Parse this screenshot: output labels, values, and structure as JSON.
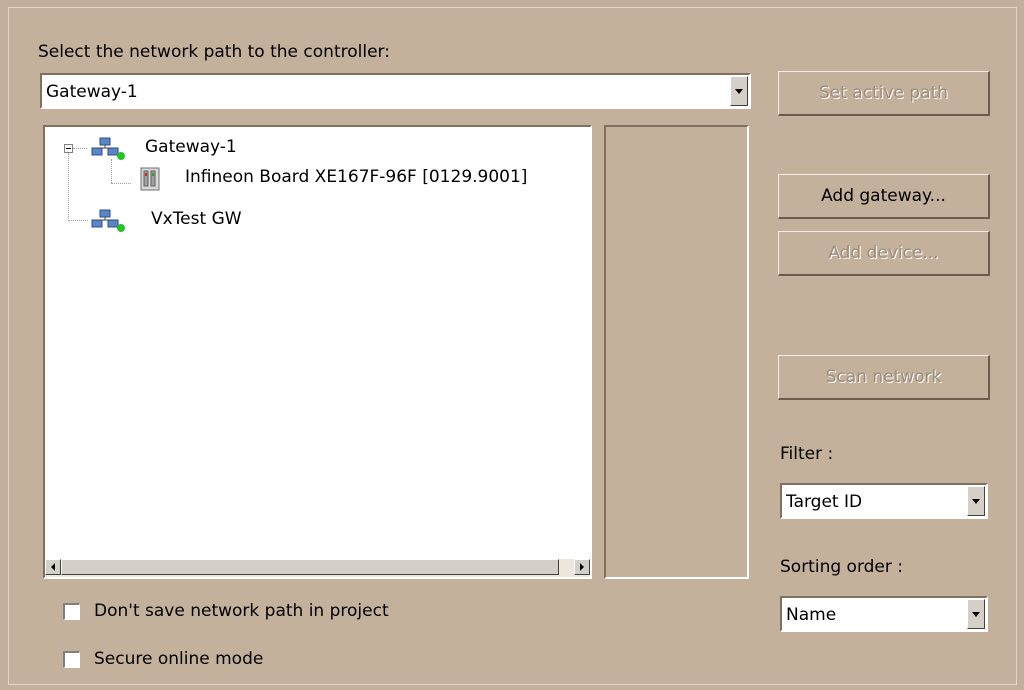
{
  "header_label": "Select the network path to the controller:",
  "path_combo": {
    "value": "Gateway-1"
  },
  "tree": {
    "nodes": [
      {
        "label": "Gateway-1",
        "icon": "network-gateway-icon",
        "status": "online",
        "expanded": true
      },
      {
        "label": "Infineon Board XE167F-96F [0129.9001]",
        "icon": "controller-device-icon"
      },
      {
        "label": "VxTest GW",
        "icon": "network-gateway-icon",
        "status": "online"
      }
    ]
  },
  "buttons": {
    "set_active_path": "Set active path",
    "add_gateway": "Add gateway...",
    "add_device": "Add device...",
    "scan_network": "Scan network"
  },
  "filter": {
    "label": "Filter :",
    "value": "Target ID"
  },
  "sorting": {
    "label": "Sorting order :",
    "value": "Name"
  },
  "checkboxes": {
    "dont_save": "Don't save network path in project",
    "secure_online": "Secure online mode"
  },
  "colors": {
    "background": "#c4b19c",
    "status_online": "#22c522",
    "disabled_text": "#9c8c7c"
  }
}
